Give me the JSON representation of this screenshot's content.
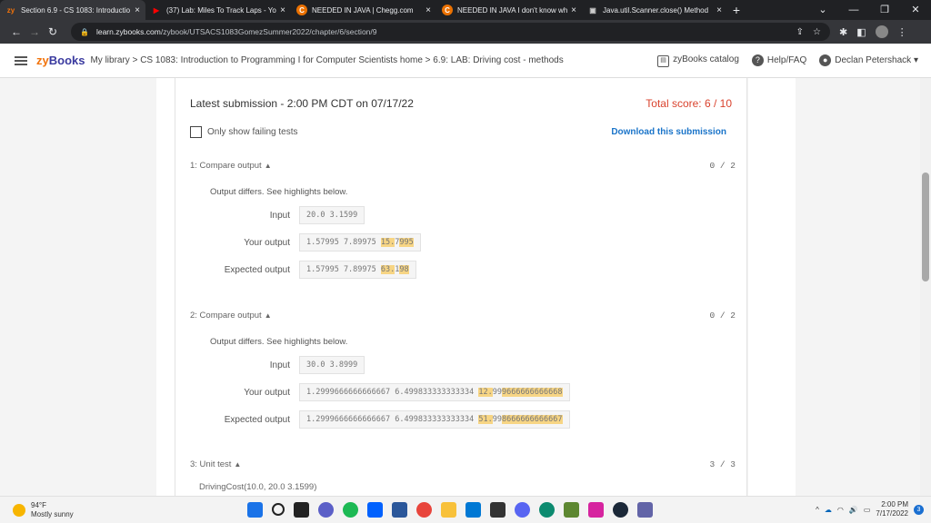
{
  "browser": {
    "tabs": [
      {
        "label": "Section 6.9 - CS 1083: Introductio",
        "icon": "zybooks-icon",
        "color": "#f2730a",
        "glyph": "zy"
      },
      {
        "label": "(37) Lab: Miles To Track Laps - Yo",
        "icon": "youtube-icon",
        "color": "#ff0000",
        "glyph": "▶"
      },
      {
        "label": "NEEDED IN JAVA | Chegg.com",
        "icon": "chegg-icon",
        "color": "#eb7100",
        "glyph": "C"
      },
      {
        "label": "NEEDED IN JAVA I don't know wh",
        "icon": "chegg-icon",
        "color": "#eb7100",
        "glyph": "C"
      },
      {
        "label": "Java.util.Scanner.close() Method",
        "icon": "tutorialspoint-icon",
        "color": "#7d7d7d",
        "glyph": "▣"
      }
    ],
    "new_tab": "+",
    "url_host": "learn.zybooks.com",
    "url_path": "/zybook/UTSACS1083GomezSummer2022/chapter/6/section/9"
  },
  "zybooks": {
    "logo_prefix": "zy",
    "logo_suffix": "Books",
    "breadcrumb": "My library > CS 1083: Introduction to Programming I for Computer Scientists home > 6.9: LAB: Driving cost - methods",
    "catalog": "zyBooks catalog",
    "help": "Help/FAQ",
    "user": "Declan Petershack"
  },
  "submission": {
    "latest": "Latest submission - 2:00 PM CDT on 07/17/22",
    "total_score": "Total score: 6 / 10",
    "only_failing": "Only show failing tests",
    "download": "Download this submission"
  },
  "tests": [
    {
      "title": "1: Compare output",
      "points": "0 / 2",
      "differs": "Output differs. See highlights below.",
      "input_label": "Input",
      "input": "20.0 3.1599",
      "your_label": "Your output",
      "your_plain": "1.57995 7.89975 ",
      "your_hl1": "15.",
      "your_mid": "7",
      "your_hl2": "995",
      "expected_label": "Expected output",
      "expected_plain": "1.57995 7.89975 ",
      "expected_hl1": "63.",
      "expected_mid": "1",
      "expected_hl2": "98"
    },
    {
      "title": "2: Compare output",
      "points": "0 / 2",
      "differs": "Output differs. See highlights below.",
      "input_label": "Input",
      "input": "30.0 3.8999",
      "your_label": "Your output",
      "your_plain": "1.2999666666666667 6.499833333333334 ",
      "your_hl1": "12.",
      "your_mid": "99",
      "your_hl2": "9666666666668",
      "expected_label": "Expected output",
      "expected_plain": "1.2999666666666667 6.499833333333334 ",
      "expected_hl1": "51.",
      "expected_mid": "99",
      "expected_hl2": "8666666666667"
    },
    {
      "title": "3: Unit test",
      "points": "3 / 3",
      "sub": "DrivingCost(10.0, 20.0 3.1599)"
    }
  ],
  "taskbar": {
    "temp": "94°F",
    "weather": "Mostly sunny",
    "time": "2:00 PM",
    "date": "7/17/2022",
    "notifications": "3"
  }
}
